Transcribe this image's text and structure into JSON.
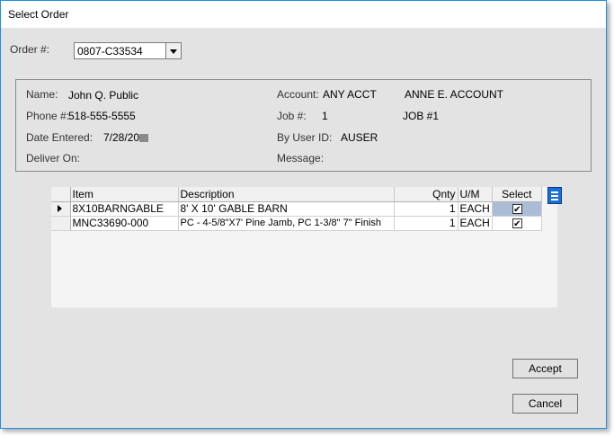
{
  "window": {
    "title": "Select Order"
  },
  "order": {
    "label": "Order #:",
    "value": "0807-C33534"
  },
  "info": {
    "name_label": "Name:",
    "name_value": "John Q. Public",
    "phone_label": "Phone #:",
    "phone_value": "518-555-5555",
    "date_label": "Date Entered:",
    "date_value": "7/28/20",
    "deliver_label": "Deliver On:",
    "account_label": "Account:",
    "account_code": "ANY ACCT",
    "account_name": "ANNE E. ACCOUNT",
    "job_label": "Job #:",
    "job_number": "1",
    "job_name": "JOB #1",
    "user_label": "By User ID:",
    "user_value": "AUSER",
    "message_label": "Message:"
  },
  "grid": {
    "columns": [
      "Item",
      "Description",
      "Qnty",
      "U/M",
      "Select"
    ],
    "rows": [
      {
        "item": "8X10BARNGABLE",
        "description": "8' X 10' GABLE BARN",
        "qnty": "1",
        "um": "EACH",
        "selected": true
      },
      {
        "item": "MNC33690-000",
        "description": "PC - 4-5/8\"X7' Pine Jamb, PC 1-3/8\" 7\" Finish",
        "qnty": "1",
        "um": "EACH",
        "selected": true
      }
    ]
  },
  "buttons": {
    "accept": "Accept",
    "cancel": "Cancel"
  },
  "colors": {
    "accent": "#1a6ed8",
    "window_border": "#1e90e0",
    "selected_cell": "#aabcd6"
  }
}
